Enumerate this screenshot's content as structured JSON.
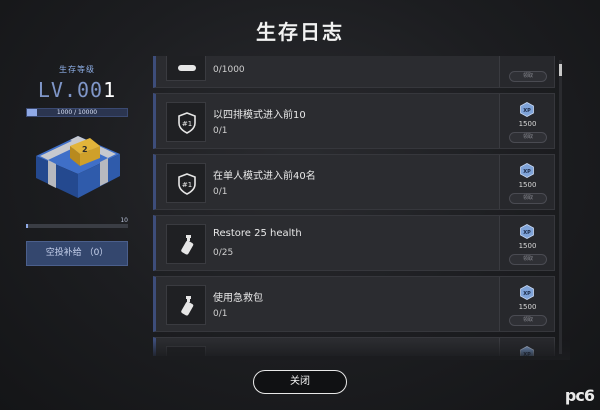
{
  "title": "生存日志",
  "left_panel": {
    "level_caption": "生存等级",
    "level_prefix": "LV.00",
    "level_last_digit": "1",
    "xp_text": "1000 / 10000",
    "xp_fraction": 0.1,
    "supply_max": "10",
    "supply_fraction": 0.02,
    "supply_button_label": "空投补给 （0）"
  },
  "tasks": [
    {
      "name": "",
      "progress": "0/1000",
      "xp": "1500",
      "claim": "领取",
      "icon": "controller-icon",
      "partial": "top"
    },
    {
      "name": "以四排模式进入前10",
      "progress": "0/1",
      "xp": "1500",
      "claim": "领取",
      "icon": "rank-shield-icon"
    },
    {
      "name": "在单人模式进入前40名",
      "progress": "0/1",
      "xp": "1500",
      "claim": "领取",
      "icon": "rank-shield-icon"
    },
    {
      "name": "Restore 25 health",
      "progress": "0/25",
      "xp": "1500",
      "claim": "领取",
      "icon": "spray-bottle-icon"
    },
    {
      "name": "使用急救包",
      "progress": "0/1",
      "xp": "1500",
      "claim": "领取",
      "icon": "spray-bottle-icon"
    },
    {
      "name": "",
      "progress": "",
      "xp": "",
      "claim": "",
      "icon": "generic-task-icon",
      "partial": "bottom"
    }
  ],
  "close_button_label": "关闭",
  "watermark": "pc6"
}
